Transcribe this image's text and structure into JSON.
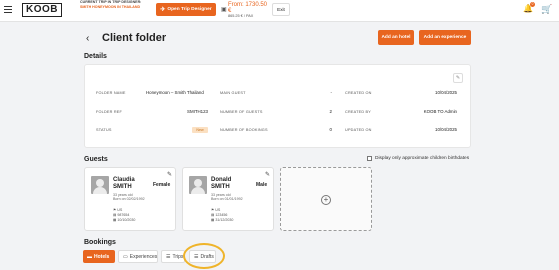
{
  "topbar": {
    "logo": "KOOB",
    "current_trip_label": "CURRENT TRIP IN TRIP DESIGNER:",
    "current_trip_value": "SMITH HONEYMOON IN THAILAND",
    "open_designer_label": "Open Trip Designer",
    "price_main": "From: 1730.50 €",
    "price_sub": "865.25 € / PAX",
    "exit_label": "Exit",
    "notification_count": "0"
  },
  "header": {
    "title": "Client folder",
    "add_hotel_label": "Add an hotel",
    "add_experience_label": "Add an experience"
  },
  "details": {
    "title": "Details",
    "folder_name_label": "FOLDER NAME",
    "folder_name_value": "Honeymoon – Smith Thailand",
    "folder_ref_label": "FOLDER REF",
    "folder_ref_value": "SMITH123",
    "status_label": "STATUS",
    "status_value": "New",
    "main_guest_label": "MAIN GUEST",
    "main_guest_value": "-",
    "number_guests_label": "NUMBER OF GUESTS",
    "number_guests_value": "2",
    "number_bookings_label": "NUMBER OF BOOKINGS",
    "number_bookings_value": "0",
    "created_on_label": "CREATED ON",
    "created_on_value": "10/04/2025",
    "created_by_label": "CREATED BY",
    "created_by_value": "KOOB TO Admin",
    "updated_on_label": "UPDATED ON",
    "updated_on_value": "10/04/2025"
  },
  "guests": {
    "title": "Guests",
    "approx_checkbox_label": "Display only approximate children birthdates",
    "items": [
      {
        "first_name": "Claudia",
        "last_name": "SMITH",
        "gender": "Female",
        "age": "33 years old",
        "born": "Born on 02/02/1992",
        "nationality": "US",
        "passport": "987654",
        "expiry": "10/10/2030"
      },
      {
        "first_name": "Donald",
        "last_name": "SMITH",
        "gender": "Male",
        "age": "33 years old",
        "born": "Born on 01/01/1992",
        "nationality": "US",
        "passport": "123456",
        "expiry": "31/12/2030"
      }
    ]
  },
  "bookings": {
    "title": "Bookings",
    "tabs": [
      {
        "label": "Hotels"
      },
      {
        "label": "Experiences"
      },
      {
        "label": "Trips"
      },
      {
        "label": "Drafts"
      }
    ]
  },
  "colors": {
    "accent": "#e8651f",
    "highlight": "#efb42a"
  }
}
